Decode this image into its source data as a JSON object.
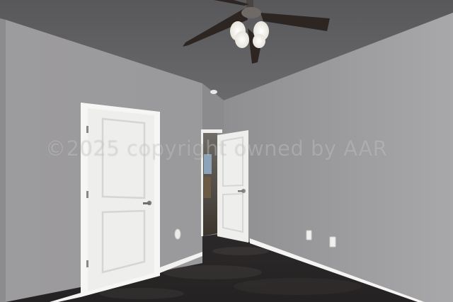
{
  "watermark": {
    "text": "©2025 copyright owned by AAR"
  },
  "colors": {
    "ceiling": "#5f5f61",
    "wall_left": "#9a999b",
    "wall_back": "#8e8d90",
    "wall_right": "#a09fa2",
    "floor": "#2c2a2a",
    "trim": "#f4f4f2",
    "door": "#eeeeec"
  },
  "objects": [
    "ceiling-fan",
    "closet-door",
    "bedroom-door",
    "hallway-opening",
    "baseboard",
    "electrical-outlet",
    "light-switch",
    "polished-concrete-floor"
  ]
}
